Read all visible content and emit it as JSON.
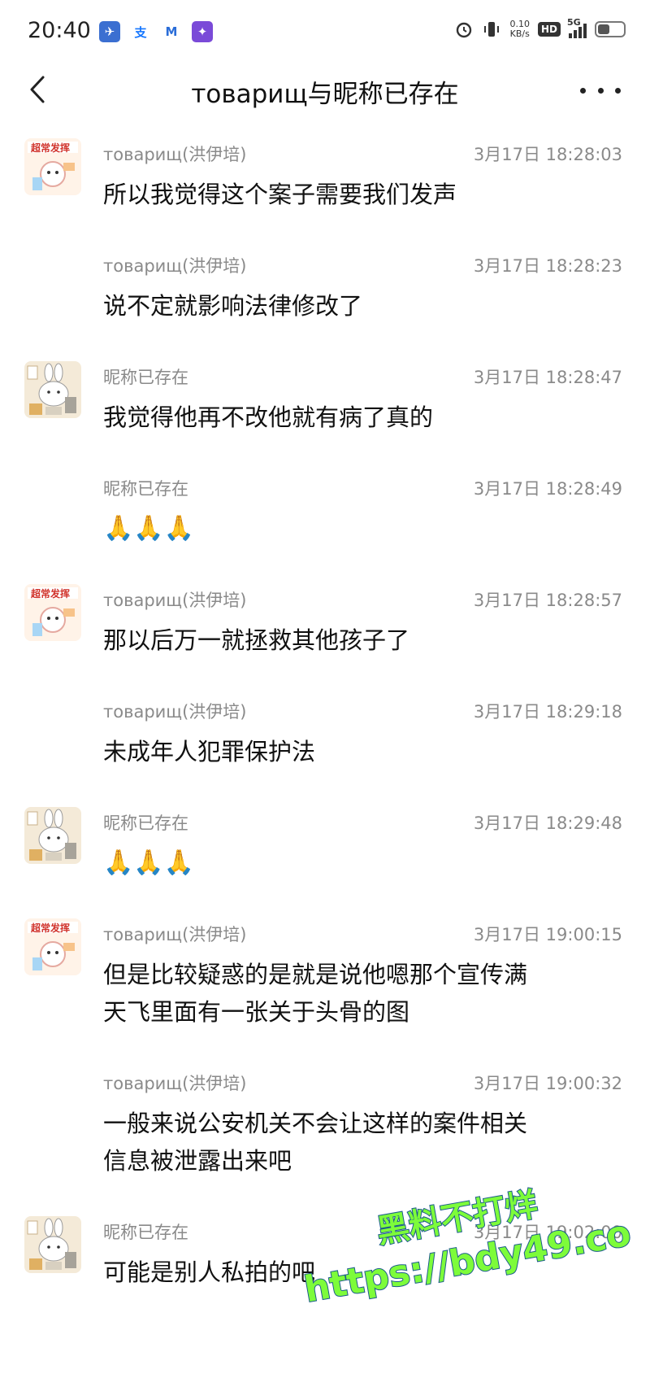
{
  "status_bar": {
    "time": "20:40",
    "network_speed_value": "0.10",
    "network_speed_unit": "KB/s",
    "hd_label": "HD",
    "signal_label": "5G",
    "battery_level": 0.45
  },
  "header": {
    "title": "товарищ与昵称已存在"
  },
  "messages": [
    {
      "sender": "товарищ(洪伊培)",
      "timestamp": "3月17日 18:28:03",
      "text": "所以我觉得这个案子需要我们发声",
      "avatar": "cartoon-avatar-1"
    },
    {
      "sender": "товарищ(洪伊培)",
      "timestamp": "3月17日 18:28:23",
      "text": "说不定就影响法律修改了"
    },
    {
      "sender": "昵称已存在",
      "timestamp": "3月17日 18:28:47",
      "text": "我觉得他再不改他就有病了真的",
      "avatar": "rabbit-avatar"
    },
    {
      "sender": "昵称已存在",
      "timestamp": "3月17日 18:28:49",
      "text": "🙏🙏🙏"
    },
    {
      "sender": "товарищ(洪伊培)",
      "timestamp": "3月17日 18:28:57",
      "text": "那以后万一就拯救其他孩子了",
      "avatar": "cartoon-avatar-1"
    },
    {
      "sender": "товарищ(洪伊培)",
      "timestamp": "3月17日 18:29:18",
      "text": "未成年人犯罪保护法"
    },
    {
      "sender": "昵称已存在",
      "timestamp": "3月17日 18:29:48",
      "text": "🙏🙏🙏",
      "avatar": "rabbit-avatar"
    },
    {
      "sender": "товарищ(洪伊培)",
      "timestamp": "3月17日 19:00:15",
      "text_lines": [
        "但是比较疑惑的是就是说他嗯那个宣传满",
        "天飞里面有一张关于头骨的图"
      ],
      "avatar": "cartoon-avatar-1"
    },
    {
      "sender": "товарищ(洪伊培)",
      "timestamp": "3月17日 19:00:32",
      "text_lines": [
        "一般来说公安机关不会让这样的案件相关",
        "信息被泄露出来吧"
      ]
    },
    {
      "sender": "昵称已存在",
      "timestamp": "3月17日 19:02:00",
      "text": "可能是别人私拍的吧",
      "avatar": "rabbit-avatar"
    }
  ],
  "watermark": {
    "line1": "黑料不打烊",
    "line2": "https://bdy49.co"
  },
  "colors": {
    "meta_text": "#8a8a8a",
    "watermark_fill": "#7dfc3a",
    "watermark_stroke": "#1b5a8c"
  }
}
